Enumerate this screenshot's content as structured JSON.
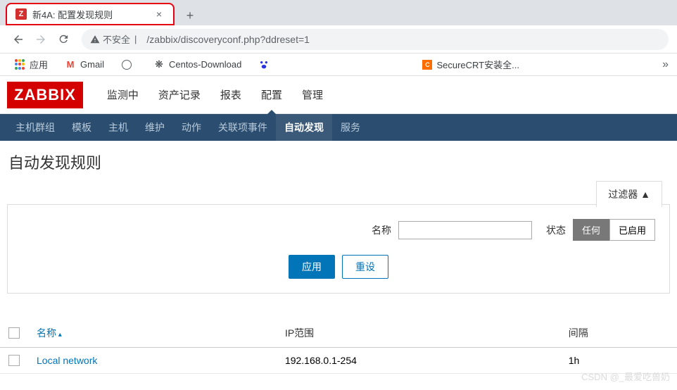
{
  "browser": {
    "tab_title": "新4A: 配置发现规则",
    "favicon_letter": "Z",
    "url_warning": "不安全",
    "url_path": "/zabbix/discoveryconf.php?ddreset=1",
    "bookmarks": {
      "apps": "应用",
      "gmail": "Gmail",
      "centos": "Centos-Download",
      "securecrt": "SecureCRT安装全..."
    }
  },
  "zabbix": {
    "logo": "ZABBIX",
    "nav": [
      "监测中",
      "资产记录",
      "报表",
      "配置",
      "管理"
    ],
    "nav_active": 3,
    "subnav": [
      "主机群组",
      "模板",
      "主机",
      "维护",
      "动作",
      "关联项事件",
      "自动发现",
      "服务"
    ],
    "subnav_active": 6,
    "page_title": "自动发现规则",
    "filter": {
      "tab_label": "过滤器 ▲",
      "name_label": "名称",
      "status_label": "状态",
      "status_opts": [
        "任何",
        "已启用"
      ],
      "apply": "应用",
      "reset": "重设"
    },
    "table": {
      "cols": {
        "name": "名称",
        "iprange": "IP范围",
        "interval": "间隔"
      },
      "rows": [
        {
          "name": "Local network",
          "iprange": "192.168.0.1-254",
          "interval": "1h"
        }
      ]
    }
  },
  "watermark": "CSDN @_最爱吃兽奶"
}
